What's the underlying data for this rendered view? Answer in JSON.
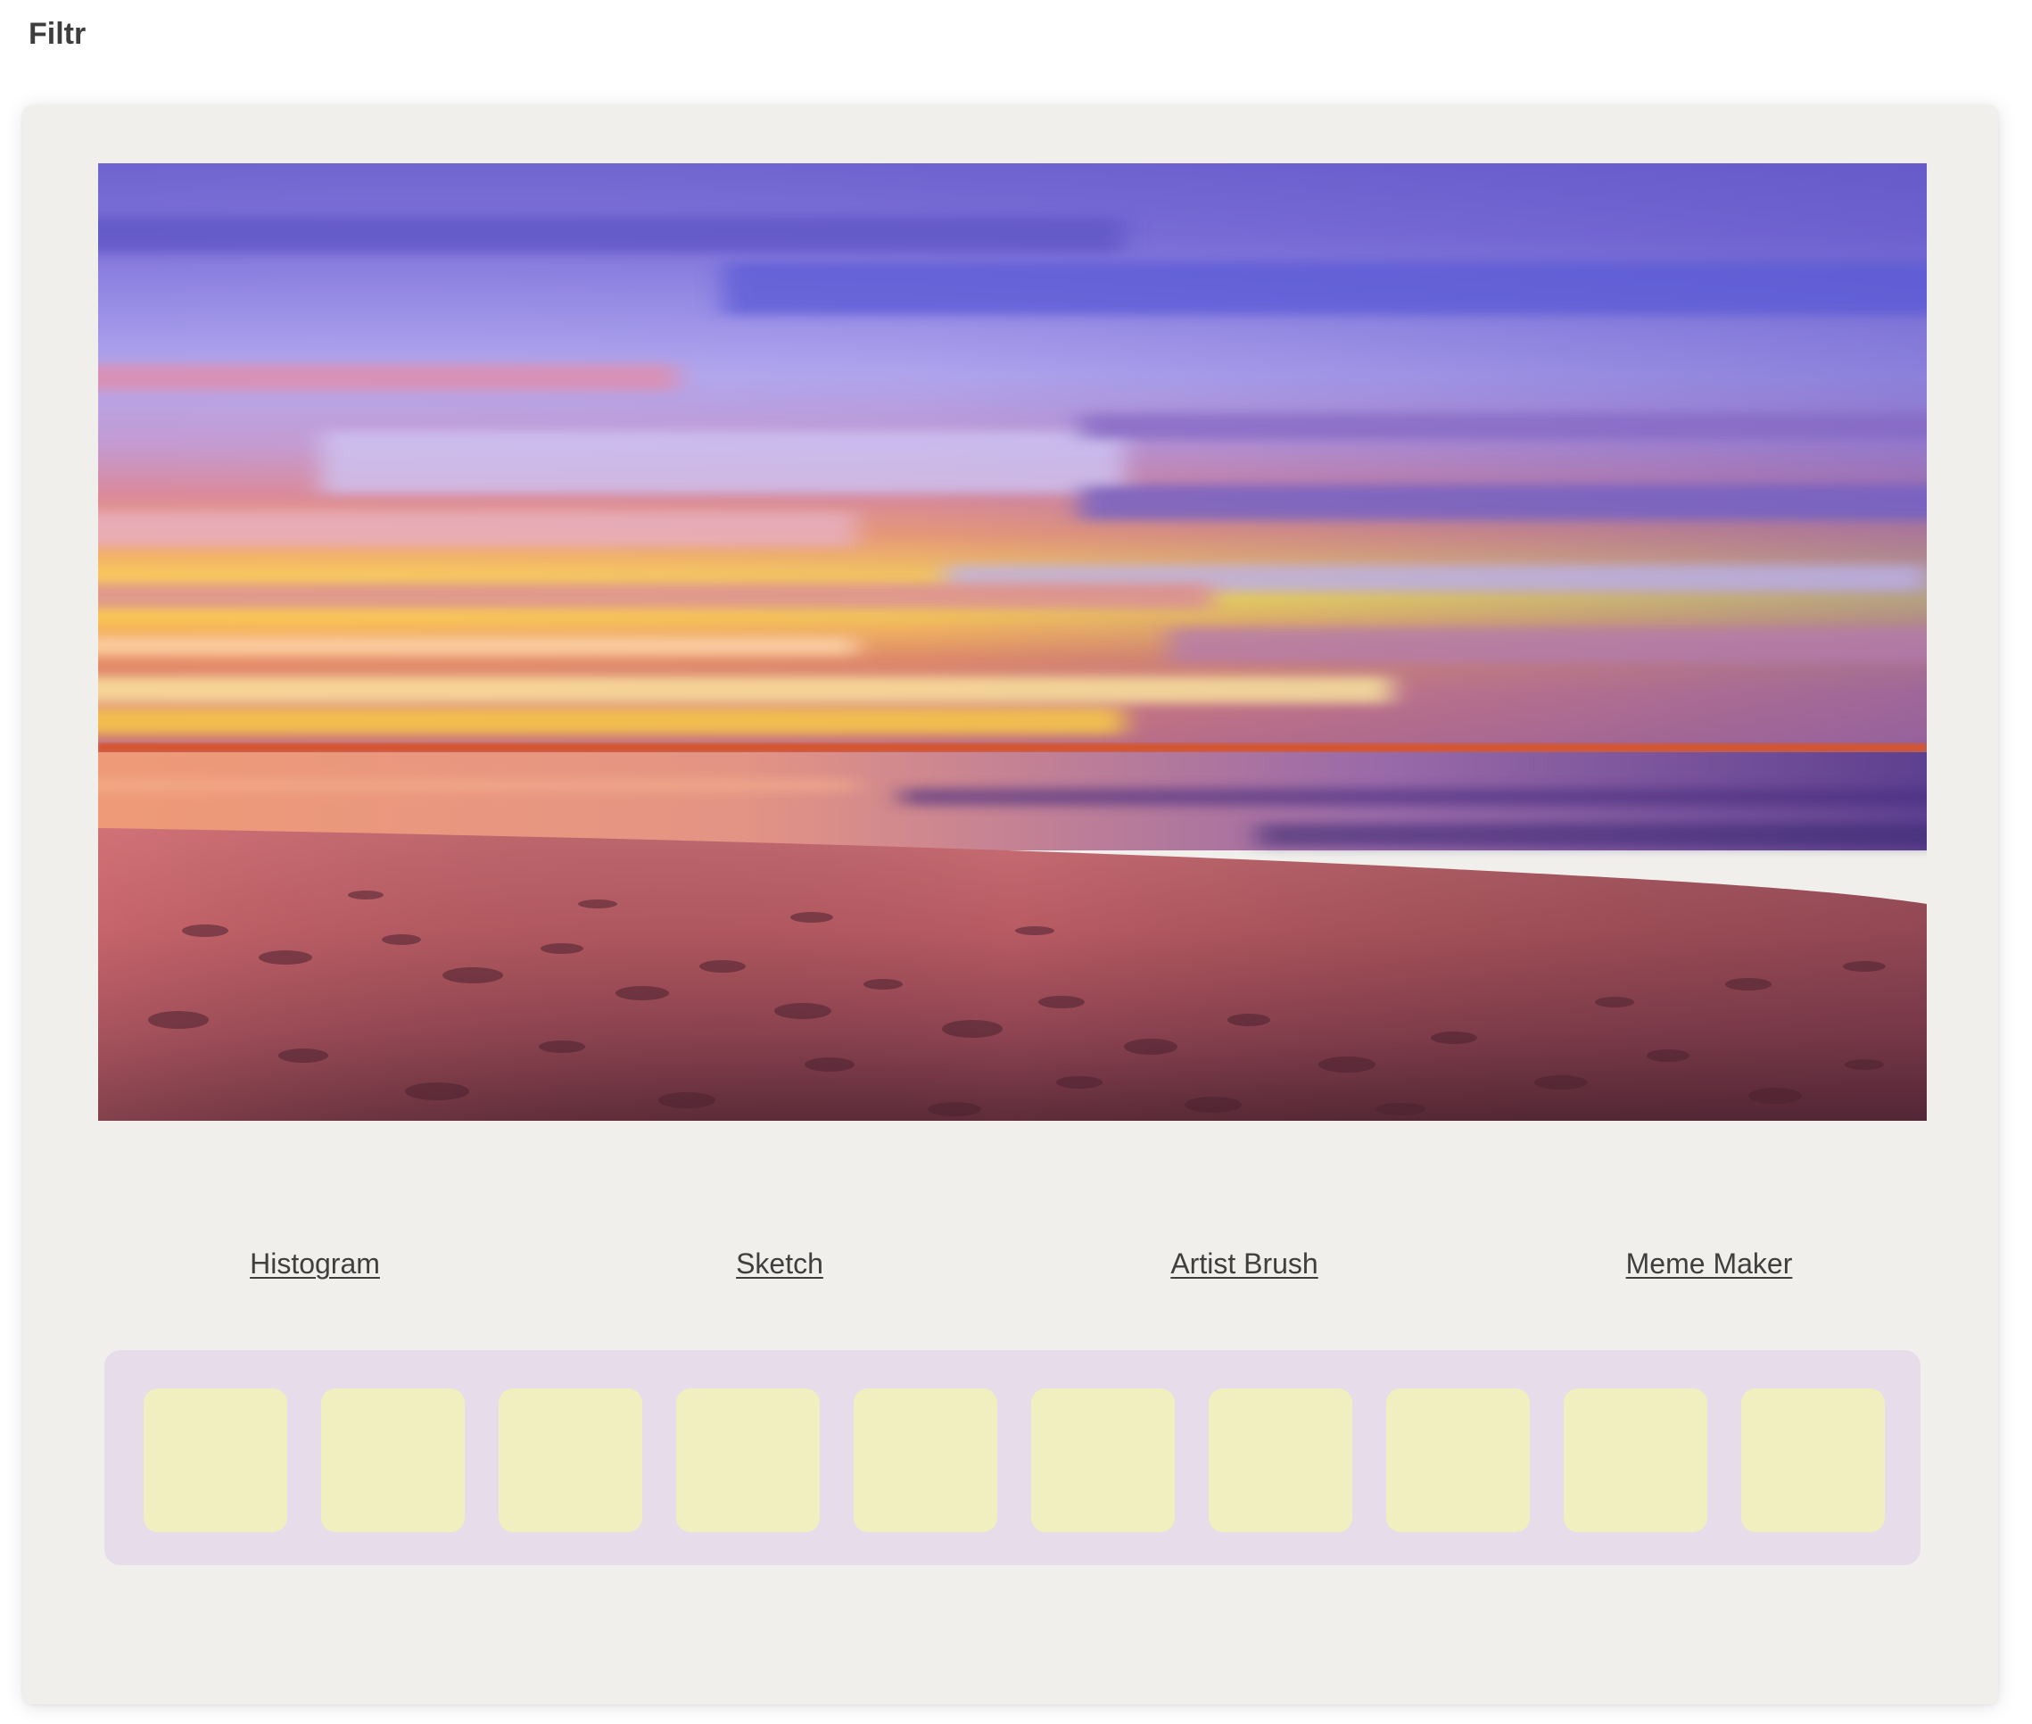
{
  "app": {
    "title": "Filtr"
  },
  "preview": {
    "image_alt": "Sunset over a beach with purple and orange sky"
  },
  "filters": [
    {
      "label": "Histogram"
    },
    {
      "label": "Sketch"
    },
    {
      "label": "Artist Brush"
    },
    {
      "label": "Meme Maker"
    }
  ],
  "tray": {
    "slot_count": 10
  },
  "colors": {
    "page_background": "#ffffff",
    "panel_background": "#f0efeb",
    "tray_background": "#e6dcea",
    "slot_background": "#f1eec0",
    "link_text": "#3f3f3f"
  }
}
